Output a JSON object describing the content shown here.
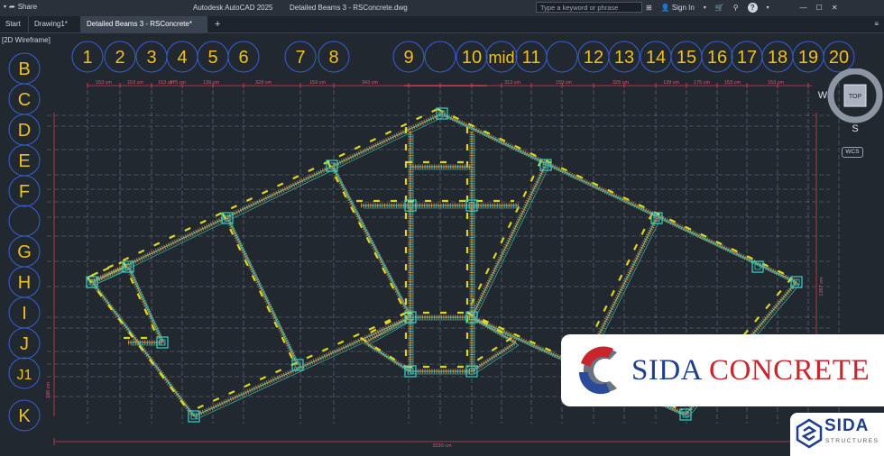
{
  "titlebar": {
    "share_label": "Share",
    "app_title": "Autodesk AutoCAD 2025",
    "doc_title": "Detailed Beams 3 - RSConcrete.dwg",
    "search_placeholder": "Type a keyword or phrase",
    "sign_in_label": "Sign In"
  },
  "tabs": [
    {
      "label": "Start"
    },
    {
      "label": "Drawing1*"
    },
    {
      "label": "Detailed Beams 3 - RSConcrete*"
    }
  ],
  "new_tab_label": "+",
  "viewport": {
    "label": "[2D Wireframe]",
    "column_grid_labels": [
      "1",
      "2",
      "3",
      "4",
      "5",
      "6",
      "7",
      "8",
      "9",
      "",
      "10",
      "mid",
      "11",
      "",
      "12",
      "13",
      "14",
      "15",
      "16",
      "17",
      "18",
      "19",
      "20"
    ],
    "row_grid_labels": [
      "B",
      "C",
      "D",
      "E",
      "F",
      "",
      "G",
      "H",
      "I",
      "J",
      "J1",
      "K"
    ],
    "top_dimensions": [
      "153 cm",
      "153 cm",
      "153 cm",
      "175 cm",
      "139 cm",
      "329 cm",
      "159 cm",
      "343 cm",
      "",
      "313 cm",
      "159 cm",
      "329 cm",
      "139 cm",
      "175 cm",
      "153 cm",
      "153 cm"
    ],
    "bottom_dimension": "3230 cm",
    "right_dimension": "1367 cm",
    "left_dimension": "186 cm"
  },
  "viewcube": {
    "top_label": "TOP",
    "west_label": "W",
    "south_label": "S",
    "wcs_label": "WCS"
  },
  "branding": {
    "main_text_blue": "SIDA",
    "main_text_red": "CONCRETE",
    "secondary_name": "SIDA",
    "secondary_sub": "STRUCTURES"
  },
  "colors": {
    "background": "#212830",
    "grid_bubble": "#3a5fd0",
    "grid_text": "#f0c020",
    "beam": "#39d0c8",
    "rebar": "#d09040",
    "dimension": "#d83c4c",
    "highlight": "#e8e020"
  }
}
